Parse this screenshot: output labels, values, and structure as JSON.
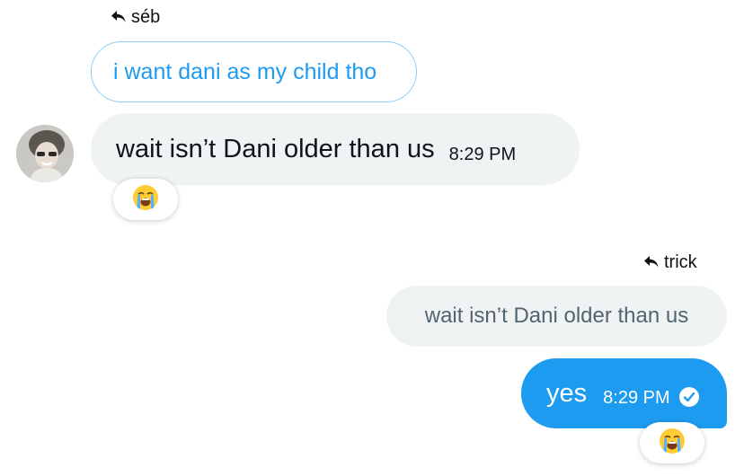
{
  "conversation": {
    "incoming_reply": {
      "reply_to_name": "séb",
      "quoted_text": "i want dani as my child tho"
    },
    "incoming_message": {
      "text": "wait isn’t Dani older than us",
      "time": "8:29 PM",
      "reaction_icon": "loudly-crying-face-emoji"
    },
    "outgoing_reply": {
      "reply_to_name": "trick",
      "quoted_text": "wait isn’t Dani older than us"
    },
    "outgoing_message": {
      "text": "yes",
      "time": "8:29 PM",
      "status_icon": "check-circle-icon",
      "reaction_icon": "loudly-crying-face-emoji"
    }
  },
  "colors": {
    "accent": "#1d9bf0",
    "bubble_grey": "#eff3f4",
    "quote_border": "#8ecdf4",
    "muted_text": "#536471"
  }
}
